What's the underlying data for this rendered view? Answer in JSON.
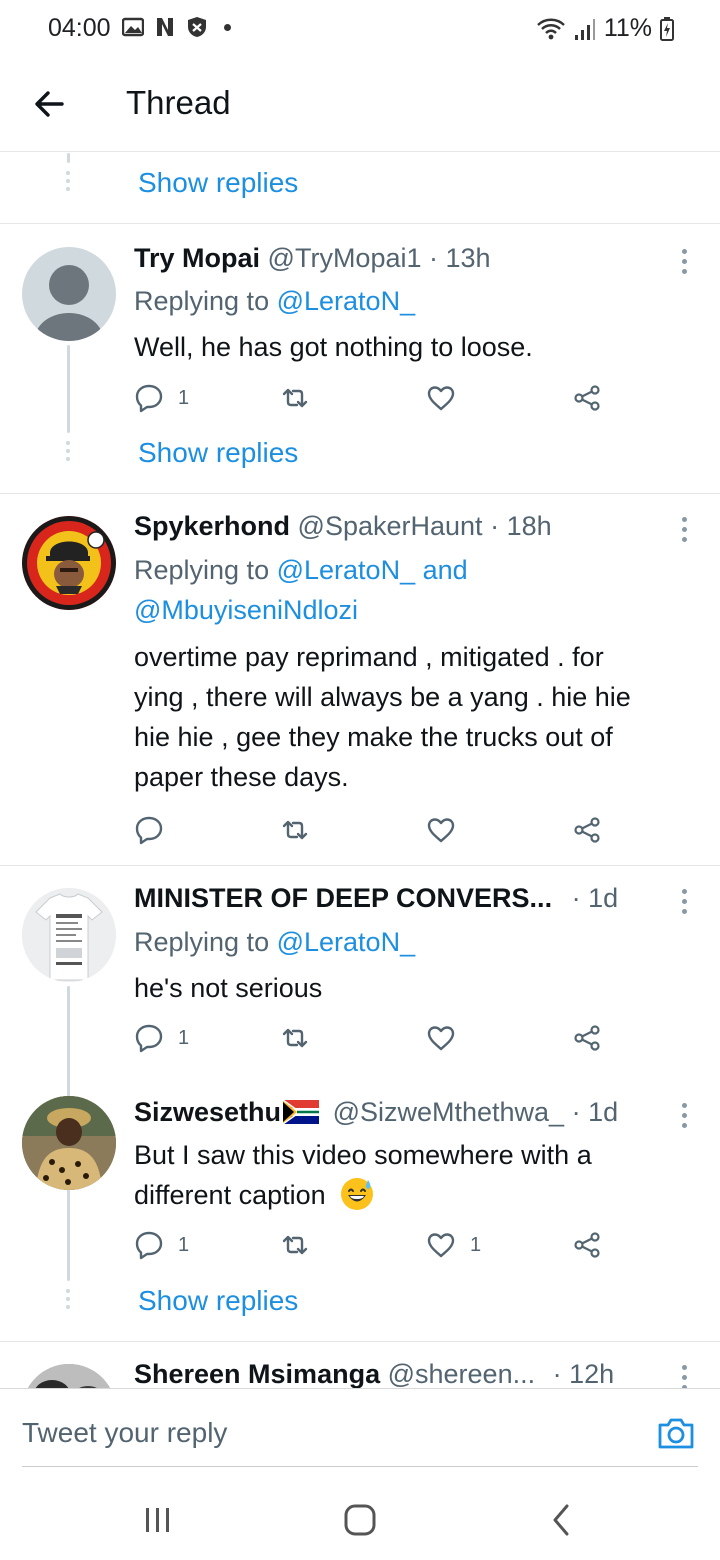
{
  "status_bar": {
    "time": "04:00",
    "battery": "11%"
  },
  "header": {
    "title": "Thread"
  },
  "show_replies_label": "Show replies",
  "tweets": [
    {
      "name": "Try Mopai",
      "handle": "@TryMopai1",
      "time": "· 13h",
      "replying_prefix": "Replying to",
      "mentions": "@LeratoN_",
      "text": "Well, he has got nothing to loose.",
      "reply_count": "1",
      "retweet_count": "",
      "like_count": ""
    },
    {
      "name": "Spykerhond",
      "handle": "@SpakerHaunt",
      "time": "· 18h",
      "replying_prefix": "Replying to",
      "mentions": "@LeratoN_ and",
      "mentions2": "@MbuyiseniNdlozi",
      "text_lines": [
        "overtime pay reprimand , mitigated . for",
        "ying , there will always be a yang . hie hie",
        "hie hie , gee they make the trucks out of",
        "paper these days."
      ],
      "reply_count": "",
      "retweet_count": "",
      "like_count": ""
    },
    {
      "name": "MINISTER OF DEEP CONVERS...",
      "handle": "",
      "time": "· 1d",
      "replying_prefix": "Replying to",
      "mentions": "@LeratoN_",
      "text": "he's not serious",
      "reply_count": "1",
      "retweet_count": "",
      "like_count": ""
    },
    {
      "name": "Sizwesethu",
      "handle": "@SizweMthethwa_",
      "time": "· 1d",
      "text_lines": [
        "But I saw this video somewhere with a",
        "different caption"
      ],
      "reply_count": "1",
      "retweet_count": "",
      "like_count": "1"
    },
    {
      "name": "Shereen Msimanga",
      "handle": "@shereen...",
      "time": "· 12h"
    }
  ],
  "reply_bar": {
    "placeholder": "Tweet your reply"
  },
  "colors": {
    "link": "#1d8fe0",
    "secondary_text": "#536471",
    "divider": "#e6e6e6"
  }
}
